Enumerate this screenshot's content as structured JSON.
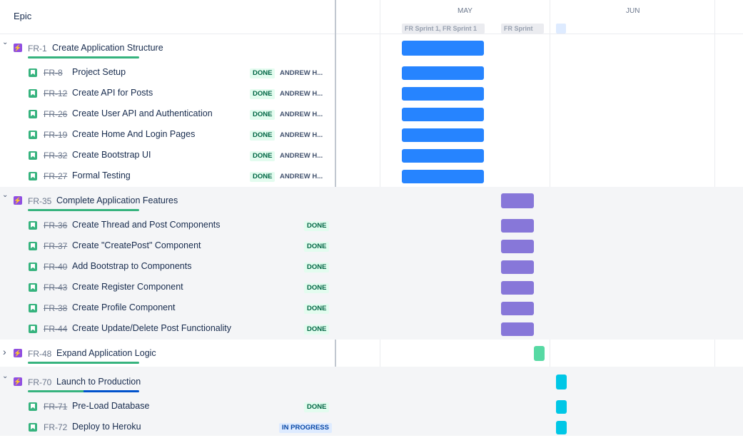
{
  "header": {
    "epic_col": "Epic",
    "months": [
      "MAY",
      "JUN"
    ],
    "sprints": [
      "FR Sprint 1, FR Sprint 1",
      "FR Sprint"
    ]
  },
  "colors": {
    "blue": "#2684ff",
    "purple": "#8777d9",
    "green": "#57d9a3",
    "teal": "#00c7e6"
  },
  "epics": [
    {
      "key": "FR-1",
      "summary": "Create Application Structure",
      "expanded": true,
      "progress_done_pct": 100,
      "bar_color": "#2684ff",
      "children": [
        {
          "key": "FR-8",
          "summary": "Project Setup",
          "status": "DONE",
          "assignee": "ANDREW H..."
        },
        {
          "key": "FR-12",
          "summary": "Create API for Posts",
          "status": "DONE",
          "assignee": "ANDREW H..."
        },
        {
          "key": "FR-26",
          "summary": "Create User API and Authentication",
          "status": "DONE",
          "assignee": "ANDREW H..."
        },
        {
          "key": "FR-19",
          "summary": "Create Home And Login Pages",
          "status": "DONE",
          "assignee": "ANDREW H..."
        },
        {
          "key": "FR-32",
          "summary": "Create Bootstrap UI",
          "status": "DONE",
          "assignee": "ANDREW H..."
        },
        {
          "key": "FR-27",
          "summary": "Formal Testing",
          "status": "DONE",
          "assignee": "ANDREW H..."
        }
      ]
    },
    {
      "key": "FR-35",
      "summary": "Complete Application Features",
      "expanded": true,
      "progress_done_pct": 100,
      "bar_color": "#8777d9",
      "children": [
        {
          "key": "FR-36",
          "summary": "Create Thread and Post Components",
          "status": "DONE"
        },
        {
          "key": "FR-37",
          "summary": "Create \"CreatePost\" Component",
          "status": "DONE"
        },
        {
          "key": "FR-40",
          "summary": "Add Bootstrap to Components",
          "status": "DONE"
        },
        {
          "key": "FR-43",
          "summary": "Create Register Component",
          "status": "DONE"
        },
        {
          "key": "FR-38",
          "summary": "Create Profile Component",
          "status": "DONE"
        },
        {
          "key": "FR-44",
          "summary": "Create Update/Delete Post Functionality",
          "status": "DONE"
        }
      ]
    },
    {
      "key": "FR-48",
      "summary": "Expand Application Logic",
      "expanded": false,
      "progress_done_pct": 100,
      "bar_color": "#57d9a3",
      "children": []
    },
    {
      "key": "FR-70",
      "summary": "Launch to Production",
      "expanded": true,
      "progress_done_pct": 50,
      "progress_inprogress_pct": 50,
      "bar_color": "#00c7e6",
      "children": [
        {
          "key": "FR-71",
          "summary": "Pre-Load Database",
          "status": "DONE"
        },
        {
          "key": "FR-72",
          "summary": "Deploy to Heroku",
          "status": "IN PROGRESS"
        }
      ]
    }
  ]
}
